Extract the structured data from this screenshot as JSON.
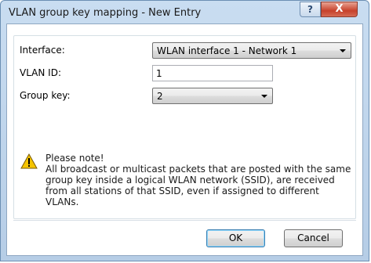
{
  "window": {
    "title": "VLAN group key mapping - New Entry",
    "help_glyph": "?",
    "close_glyph": "X"
  },
  "form": {
    "interface": {
      "label": "Interface:",
      "value": "WLAN interface 1 - Network 1"
    },
    "vlan_id": {
      "label": "VLAN ID:",
      "value": "1"
    },
    "group_key": {
      "label": "Group key:",
      "value": "2"
    }
  },
  "note": {
    "icon": "warning-icon",
    "title": "Please note!",
    "text": "All broadcast or multicast packets that are posted with the same group key inside a logical WLAN network (SSID), are received from all stations of that SSID, even if assigned to different VLANs."
  },
  "buttons": {
    "ok": "OK",
    "cancel": "Cancel"
  },
  "colors": {
    "accent": "#3c7fb1",
    "close": "#c7412b",
    "warning": "#f5c400"
  }
}
